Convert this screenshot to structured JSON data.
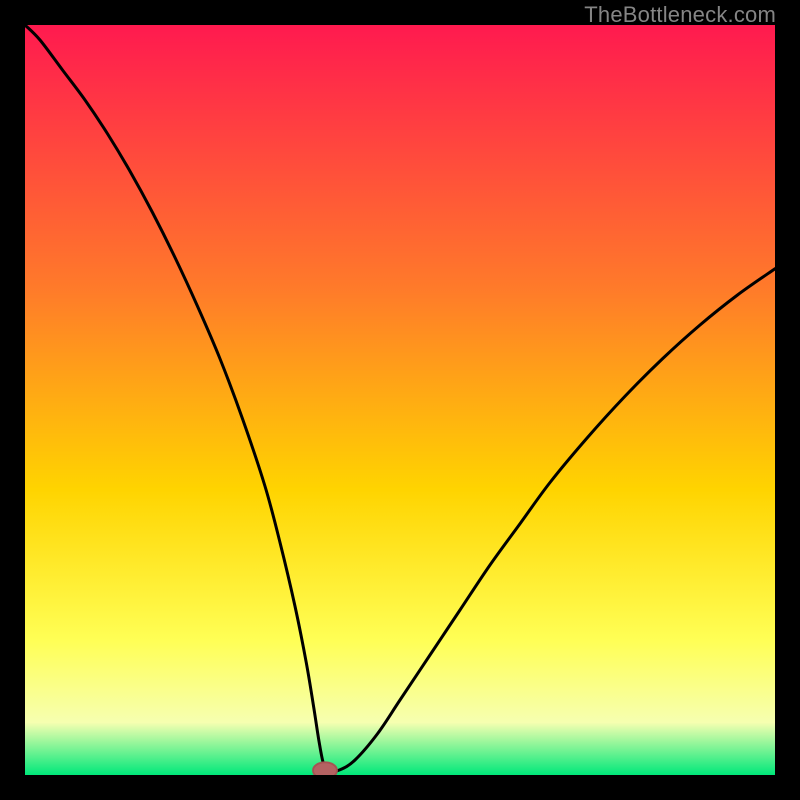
{
  "watermark": "TheBottleneck.com",
  "colors": {
    "black": "#000000",
    "curve": "#000000",
    "marker_fill": "#b46262",
    "marker_stroke": "#a65353",
    "grad_top": "#ff1a4f",
    "grad_mid1": "#ff7a2a",
    "grad_mid2": "#ffd400",
    "grad_low1": "#ffff55",
    "grad_low2": "#f6ffb0",
    "grad_bottom": "#00e87a"
  },
  "chart_data": {
    "type": "line",
    "title": "",
    "xlabel": "",
    "ylabel": "",
    "xlim": [
      0,
      100
    ],
    "ylim": [
      0,
      100
    ],
    "legend": false,
    "grid": false,
    "series": [
      {
        "name": "bottleneck-curve",
        "x": [
          0,
          2,
          5,
          8,
          11,
          14,
          17,
          20,
          23,
          26,
          29,
          32,
          34,
          36,
          37.5,
          38.5,
          39.2,
          39.8,
          40.5,
          42,
          44,
          47,
          50,
          54,
          58,
          62,
          66,
          70,
          75,
          80,
          85,
          90,
          95,
          100
        ],
        "y": [
          100,
          98,
          94,
          90,
          85.5,
          80.5,
          75,
          69,
          62.5,
          55.5,
          47.5,
          38.5,
          31,
          22.5,
          15,
          9,
          4.5,
          1.5,
          0.5,
          0.7,
          2,
          5.5,
          10,
          16,
          22,
          28,
          33.5,
          39,
          45,
          50.5,
          55.5,
          60,
          64,
          67.5
        ]
      }
    ],
    "marker": {
      "name": "optimal-point",
      "x": 40,
      "y": 0.6,
      "rx": 1.6,
      "ry": 1.1
    }
  }
}
